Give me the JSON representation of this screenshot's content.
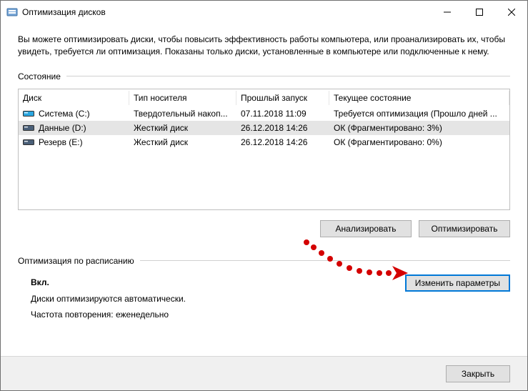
{
  "title": "Оптимизация дисков",
  "description": "Вы можете оптимизировать диски, чтобы повысить эффективность работы компьютера, или проанализировать их, чтобы увидеть, требуется ли оптимизация. Показаны только диски, установленные в компьютере или подключенные к нему.",
  "state_label": "Состояние",
  "columns": {
    "disk": "Диск",
    "media": "Тип носителя",
    "last": "Прошлый запуск",
    "status": "Текущее состояние"
  },
  "rows": [
    {
      "disk": "Система (C:)",
      "media": "Твердотельный накоп...",
      "last": "07.11.2018 11:09",
      "status": "Требуется оптимизация (Прошло дней ...",
      "selected": false,
      "iconColor": "#2aa6e0"
    },
    {
      "disk": "Данные (D:)",
      "media": "Жесткий диск",
      "last": "26.12.2018 14:26",
      "status": "ОК (Фрагментировано: 3%)",
      "selected": true,
      "iconColor": "#4a5f78"
    },
    {
      "disk": "Резерв (E:)",
      "media": "Жесткий диск",
      "last": "26.12.2018 14:26",
      "status": "ОК (Фрагментировано: 0%)",
      "selected": false,
      "iconColor": "#4a5f78"
    }
  ],
  "buttons": {
    "analyze": "Анализировать",
    "optimize": "Оптимизировать",
    "change": "Изменить параметры",
    "close": "Закрыть"
  },
  "schedule": {
    "header": "Оптимизация по расписанию",
    "on": "Вкл.",
    "auto": "Диски оптимизируются автоматически.",
    "freq": "Частота повторения: еженедельно"
  }
}
